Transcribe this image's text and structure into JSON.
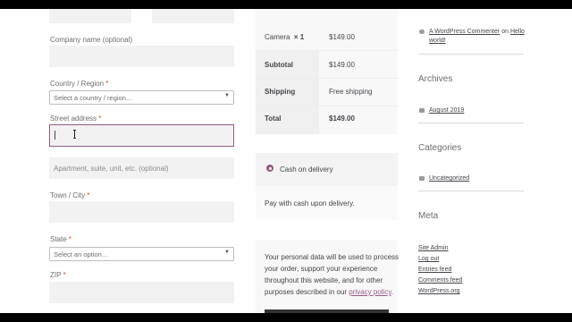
{
  "form": {
    "company_label": "Company name (optional)",
    "country_label": "Country / Region",
    "country_placeholder": "Select a country / region…",
    "street_label": "Street address",
    "apartment_placeholder": "Apartment, suite, unit, etc. (optional)",
    "town_label": "Town / City",
    "state_label": "State",
    "state_placeholder": "Select an option…",
    "zip_label": "ZIP",
    "required_mark": "*",
    "dropdown_arrow": "▼"
  },
  "order": {
    "item_name": "Camera",
    "item_qty": "× 1",
    "item_price": "$149.00",
    "subtotal_label": "Subtotal",
    "subtotal_value": "$149.00",
    "shipping_label": "Shipping",
    "shipping_value": "Free shipping",
    "total_label": "Total",
    "total_value": "$149.00"
  },
  "payment": {
    "method_label": "Cash on delivery",
    "description": "Pay with cash upon delivery.",
    "privacy_text": [
      "Your personal data will be used to process",
      "your order, support your experience",
      "throughout this website, and for other",
      "purposes described in our"
    ],
    "privacy_link": "privacy policy",
    "privacy_end": "."
  },
  "sidebar": {
    "comment_author": "A WordPress Commenter",
    "comment_on": "on",
    "comment_post_line1": "Hello",
    "comment_post_line2": "world!",
    "archives_title": "Archives",
    "archive_item": "August 2019",
    "categories_title": "Categories",
    "category_item": "Uncategorized",
    "meta_title": "Meta",
    "meta_items": [
      "Site Admin",
      "Log out",
      "Entries feed",
      "Comments feed",
      "WordPress.org"
    ]
  },
  "colors": {
    "accent": "#96588a",
    "required": "#e2401c",
    "field_bg": "#f2f2f2"
  }
}
